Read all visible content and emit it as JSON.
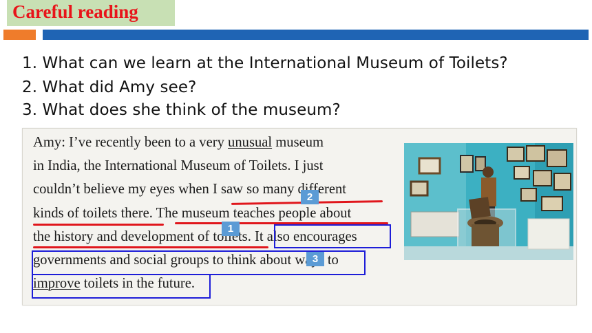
{
  "header": {
    "title": "Careful reading",
    "accent_colors": {
      "title_bg": "#c8e0b4",
      "title_text": "#e8141a",
      "bar_left": "#ef7c2b",
      "bar_right": "#1f64b4"
    }
  },
  "questions": [
    "1. What can we learn at the International Museum of Toilets?",
    "2. What did Amy see?",
    "3. What does she think of the museum?"
  ],
  "passage": {
    "l1a": "Amy: I’ve recently been to a very ",
    "l1u": "unusual",
    "l1b": " museum",
    "l2": "in India, the International Museum of Toilets. I just",
    "l3": "couldn’t believe my eyes when I saw so many different",
    "l4": "kinds of toilets there. The museum teaches people about",
    "l5": "the history and development of toilets. It also encourages",
    "l6": "governments and social groups to think about ways to",
    "l7u": "improve",
    "l7b": " toilets in the future."
  },
  "tags": [
    "2",
    "1",
    "3"
  ],
  "annotation_colors": {
    "underline": "#e0161c",
    "box": "#1d1dd8",
    "tag": "#5b9bd5"
  }
}
